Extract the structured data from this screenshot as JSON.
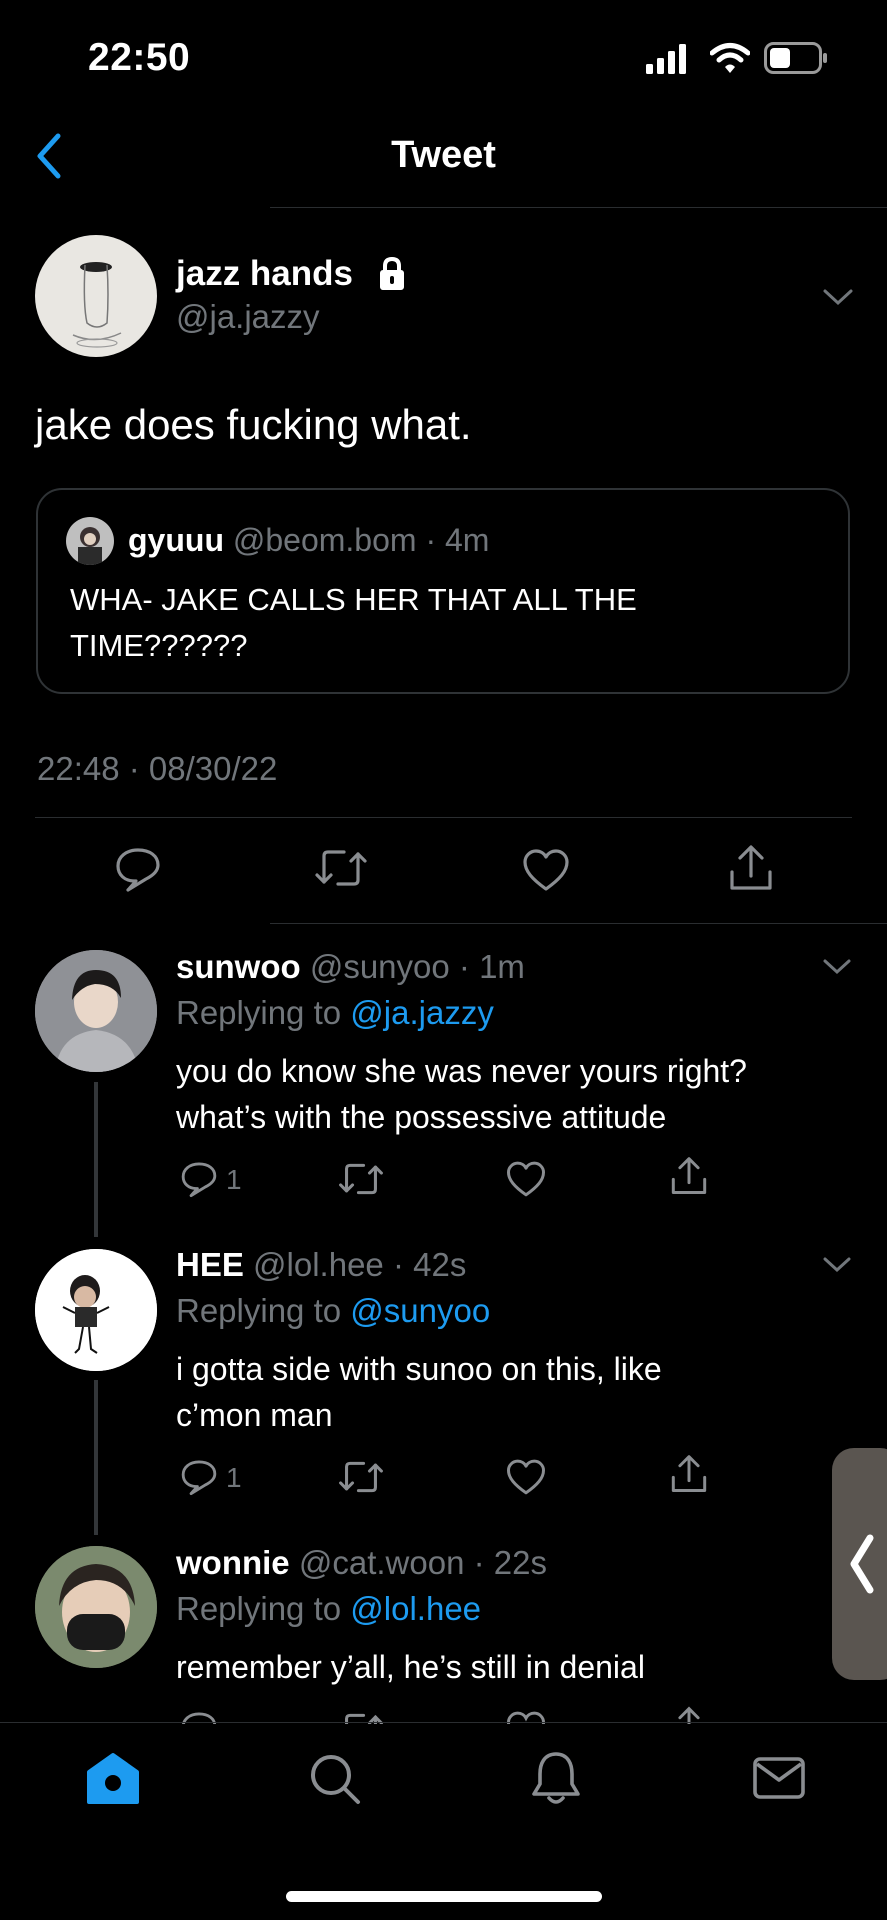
{
  "status_bar": {
    "time": "22:50"
  },
  "header": {
    "title": "Tweet"
  },
  "tweet": {
    "author_name": "jazz hands",
    "author_handle": "@ja.jazzy",
    "text": "jake does fucking what.",
    "quoted": {
      "name": "gyuuu",
      "handle": "@beom.bom",
      "time": "4m",
      "text_line1": "WHA- JAKE CALLS HER THAT ALL THE",
      "text_line2": "TIME??????"
    },
    "timestamp": "22:48 · 08/30/22"
  },
  "replies": [
    {
      "name": "sunwoo",
      "handle": "@sunyoo",
      "time": "1m",
      "replying_label": "Replying to",
      "replying_to": "@ja.jazzy",
      "line1": "you do know she was never yours right?",
      "line2": "what’s with the possessive attitude",
      "reply_count": "1"
    },
    {
      "name": "HEE",
      "handle": "@lol.hee",
      "time": "42s",
      "replying_label": "Replying to",
      "replying_to": "@sunyoo",
      "line1": "i gotta side with sunoo on this, like",
      "line2": "c’mon man",
      "reply_count": "1"
    },
    {
      "name": "wonnie",
      "handle": "@cat.woon",
      "time": "22s",
      "replying_label": "Replying to",
      "replying_to": "@lol.hee",
      "line1": "remember y’all, he’s still in denial"
    }
  ],
  "colors": {
    "accent": "#1d9bf0",
    "muted": "#71767b",
    "background": "#000000",
    "divider": "#2a2d30"
  },
  "icons": [
    "back-chevron-icon",
    "lock-icon",
    "chevron-down-icon",
    "reply-icon",
    "retweet-icon",
    "like-icon",
    "share-icon",
    "home-icon",
    "search-icon",
    "bell-icon",
    "mail-icon"
  ]
}
